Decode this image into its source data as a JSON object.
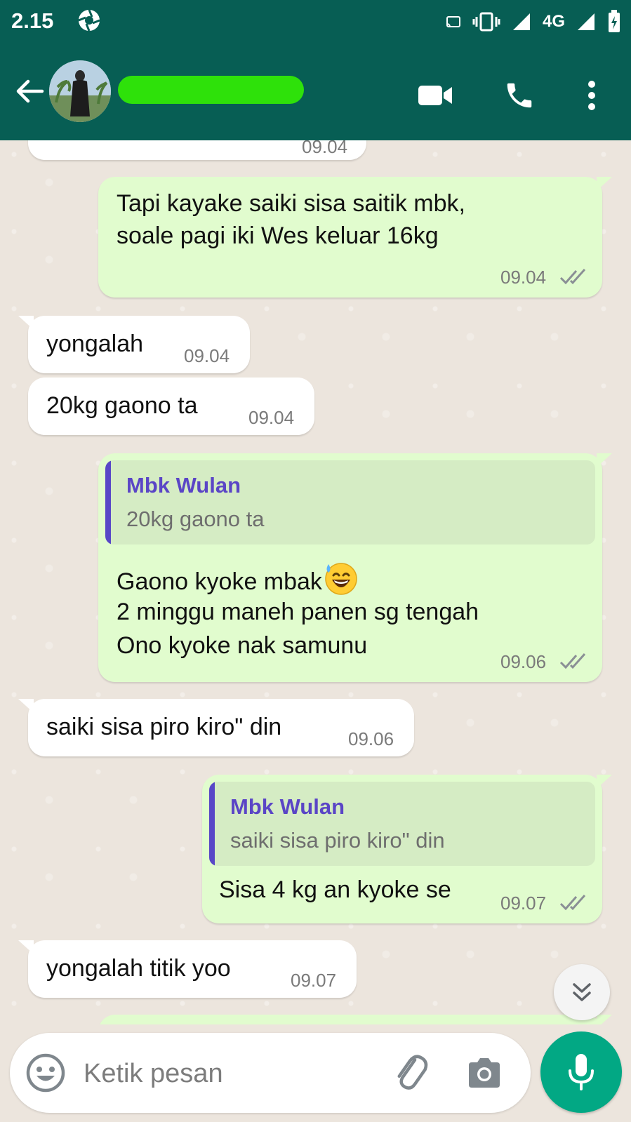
{
  "status_bar": {
    "time": "2.15",
    "network": "4G"
  },
  "header": {
    "contact_name_redacted": true
  },
  "messages": [
    {
      "direction": "in",
      "text": "",
      "time": "09.04"
    },
    {
      "direction": "out",
      "lines": [
        "Tapi kayake saiki sisa saitik mbk,",
        "soale pagi iki Wes keluar 16kg"
      ],
      "time": "09.04",
      "read": true
    },
    {
      "direction": "in",
      "text": "yongalah",
      "time": "09.04"
    },
    {
      "direction": "in",
      "text": "20kg gaono ta",
      "time": "09.04"
    },
    {
      "direction": "out",
      "quote": {
        "name": "Mbk Wulan",
        "text": "20kg gaono ta"
      },
      "lines": [
        "Gaono kyoke mbak",
        "2 minggu maneh panen sg tengah",
        "Ono kyoke nak samunu"
      ],
      "emoji": "sweat-smile-emoji",
      "time": "09.06",
      "read": true
    },
    {
      "direction": "in",
      "text": "saiki sisa piro kiro\" din",
      "time": "09.06"
    },
    {
      "direction": "out",
      "quote": {
        "name": "Mbk Wulan",
        "text": "saiki sisa piro kiro\" din"
      },
      "lines": [
        "Sisa 4 kg an kyoke se"
      ],
      "time": "09.07",
      "read": true
    },
    {
      "direction": "in",
      "text": "yongalah titik yoo",
      "time": "09.07"
    }
  ],
  "composer": {
    "placeholder": "Ketik pesan"
  },
  "colors": {
    "header": "#075e54",
    "outgoing_bubble": "#e1fcce",
    "incoming_bubble": "#ffffff",
    "quote_accent": "#5a45c6",
    "mic_button": "#02a884",
    "name_redaction": "#2ee10a"
  },
  "icons": [
    "back-arrow-icon",
    "video-call-icon",
    "voice-call-icon",
    "more-options-icon",
    "scroll-down-icon",
    "emoji-icon",
    "attach-icon",
    "camera-icon",
    "mic-icon",
    "double-check-icon"
  ]
}
